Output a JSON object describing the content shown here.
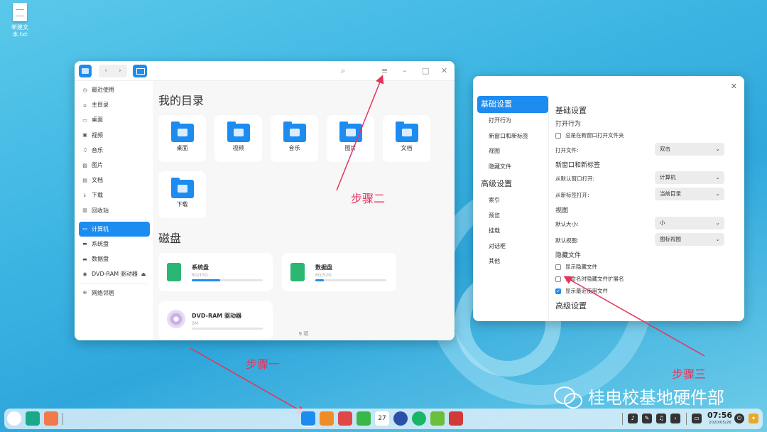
{
  "desktop": {
    "file_label": "新建文本.txt"
  },
  "file_manager": {
    "sidebar": [
      {
        "label": "最近使用",
        "icon": "clock-icon"
      },
      {
        "label": "主目录",
        "icon": "home-icon"
      },
      {
        "label": "桌面",
        "icon": "desktop-icon"
      },
      {
        "label": "视频",
        "icon": "video-icon"
      },
      {
        "label": "音乐",
        "icon": "music-icon"
      },
      {
        "label": "图片",
        "icon": "picture-icon"
      },
      {
        "label": "文档",
        "icon": "document-icon"
      },
      {
        "label": "下载",
        "icon": "download-icon"
      },
      {
        "label": "回收站",
        "icon": "trash-icon"
      },
      {
        "label": "计算机",
        "icon": "computer-icon",
        "active": true
      },
      {
        "label": "系统盘",
        "icon": "disk-icon"
      },
      {
        "label": "数据盘",
        "icon": "disk-icon"
      },
      {
        "label": "DVD-RAM 驱动器",
        "icon": "dvd-icon"
      },
      {
        "label": "网络邻居",
        "icon": "network-icon"
      }
    ],
    "section_my_dirs": "我的目录",
    "folders": [
      "桌面",
      "视频",
      "音乐",
      "图片",
      "文档",
      "下载"
    ],
    "section_disks": "磁盘",
    "disks": [
      {
        "name": "系统盘",
        "size": "6G/15G",
        "usage": 0.4
      },
      {
        "name": "数据盘",
        "size": "6G/52G",
        "usage": 0.12
      },
      {
        "name": "DVD-RAM 驱动器",
        "size": "0M",
        "usage": 0
      }
    ],
    "status": "9 项"
  },
  "settings": {
    "nav": [
      {
        "label": "基础设置",
        "type": "group",
        "active": true
      },
      {
        "label": "打开行为",
        "type": "sub"
      },
      {
        "label": "新窗口和新标签",
        "type": "sub"
      },
      {
        "label": "视图",
        "type": "sub"
      },
      {
        "label": "隐藏文件",
        "type": "sub"
      },
      {
        "label": "高级设置",
        "type": "group"
      },
      {
        "label": "索引",
        "type": "sub"
      },
      {
        "label": "预览",
        "type": "sub"
      },
      {
        "label": "挂载",
        "type": "sub"
      },
      {
        "label": "对话框",
        "type": "sub"
      },
      {
        "label": "其他",
        "type": "sub"
      }
    ],
    "body": {
      "basic_title": "基础设置",
      "open_behavior": "打开行为",
      "always_new_window": "总是在新窗口打开文件夹",
      "open_file_label": "打开文件:",
      "open_file_value": "双击",
      "new_window_tab": "新窗口和新标签",
      "from_default_window_label": "从默认窗口打开:",
      "from_default_window_value": "计算机",
      "from_new_tab_label": "从新标签打开:",
      "from_new_tab_value": "当前目录",
      "view": "视图",
      "default_size_label": "默认大小:",
      "default_size_value": "小",
      "default_view_label": "默认视图:",
      "default_view_value": "图标视图",
      "hidden_files": "隐藏文件",
      "show_hidden": "显示隐藏文件",
      "hide_ext_rename": "重命名时隐藏文件扩展名",
      "show_recent": "显示最近使用文件",
      "advanced_title": "高级设置"
    }
  },
  "annotations": {
    "step1": "步骤一",
    "step2": "步骤二",
    "step3": "步骤三"
  },
  "watermark": "桂电校基地硬件部",
  "taskbar": {
    "time": "07:56",
    "date": "2020/05/26"
  },
  "colors": {
    "accent": "#1d8cf0",
    "annotation": "#e8325a"
  }
}
